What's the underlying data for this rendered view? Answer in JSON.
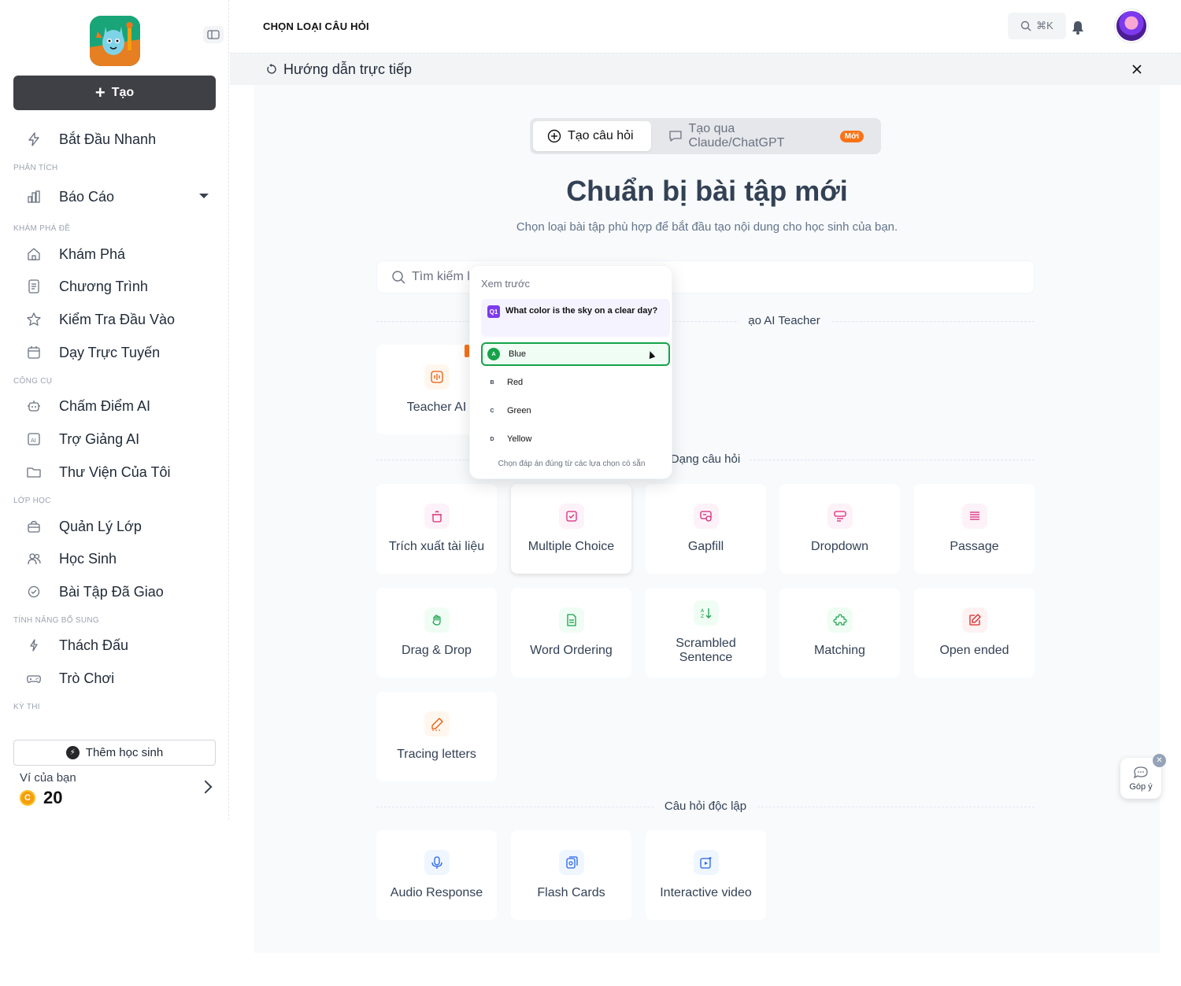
{
  "header": {
    "page_title": "CHỌN LOẠI CÂU HỎI",
    "search_shortcut": "⌘K"
  },
  "sidebar": {
    "create_label": "Tạo",
    "quick_start": "Bắt Đầu Nhanh",
    "sections": {
      "analysis": "PHÂN TÍCH",
      "explore": "KHÁM PHÁ ĐỀ",
      "tools": "CÔNG CỤ",
      "classroom": "LỚP HỌC",
      "extras": "TÍNH NĂNG BỔ SUNG",
      "exams": "KỲ THI"
    },
    "items": {
      "reports": "Báo Cáo",
      "explore": "Khám Phá",
      "curriculum": "Chương Trình",
      "placement": "Kiểm Tra Đầu Vào",
      "online": "Dạy Trực Tuyến",
      "ai_grading": "Chấm Điểm AI",
      "ai_assistant": "Trợ Giảng AI",
      "library": "Thư Viện Của Tôi",
      "class_mgmt": "Quản Lý Lớp",
      "students": "Học Sinh",
      "assigned": "Bài Tập Đã Giao",
      "challenge": "Thách Đấu",
      "games": "Trò Chơi"
    },
    "add_student": "Thêm học sinh",
    "wallet_label": "Ví của bạn",
    "wallet_coin": "C",
    "wallet_amount": "20"
  },
  "guide": {
    "text": "Hướng dẫn trực tiếp"
  },
  "main": {
    "tabs": [
      {
        "label": "Tạo câu hỏi"
      },
      {
        "label": "Tạo qua Claude/ChatGPT",
        "badge": "Mới"
      }
    ],
    "headline": "Chuẩn bị bài tập mới",
    "subline": "Chọn loại bài tập phù hợp để bắt đầu tạo nội dung cho học sinh của bạn.",
    "search_placeholder": "Tìm kiếm lo",
    "section_ai": "ạo AI Teacher",
    "section_types": "Dạng câu hỏi",
    "section_standalone": "Câu hỏi độc lập",
    "cards": {
      "teacher_ai": "Teacher AI",
      "extract": "Trích xuất tài liệu",
      "multiple_choice": "Multiple Choice",
      "gapfill": "Gapfill",
      "dropdown": "Dropdown",
      "passage": "Passage",
      "drag_drop": "Drag & Drop",
      "word_ordering": "Word Ordering",
      "scrambled": "Scrambled Sentence",
      "matching": "Matching",
      "open_ended": "Open ended",
      "tracing": "Tracing letters",
      "audio": "Audio Response",
      "flash": "Flash Cards",
      "video": "Interactive video"
    }
  },
  "preview": {
    "title": "Xem trước",
    "q_num": "Q1",
    "question": "What color is the sky on a clear day?",
    "options": [
      {
        "letter": "A",
        "text": "Blue"
      },
      {
        "letter": "B",
        "text": "Red"
      },
      {
        "letter": "C",
        "text": "Green"
      },
      {
        "letter": "D",
        "text": "Yellow"
      }
    ],
    "hint": "Chọn đáp án đúng từ các lựa chọn có sẵn"
  },
  "feedback": {
    "label": "Góp ý"
  },
  "colors": {
    "accent_dark": "#3f3f46",
    "correct_green": "#16a34a",
    "badge_orange": "#f97316"
  }
}
